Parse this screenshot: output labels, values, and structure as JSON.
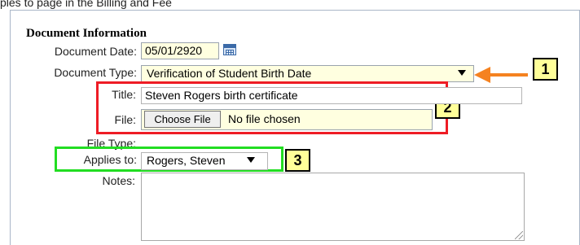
{
  "page": {
    "top_caption": "ples to page in the Billing and Fee"
  },
  "section": {
    "title": "Document Information"
  },
  "fields": {
    "document_date": {
      "label": "Document Date:",
      "value": "05/01/2920"
    },
    "document_type": {
      "label": "Document Type:",
      "value": "Verification of Student Birth Date"
    },
    "title": {
      "label": "Title:",
      "value": "Steven Rogers birth certificate"
    },
    "file": {
      "label": "File:",
      "button_label": "Choose File",
      "status": "No file chosen"
    },
    "file_type": {
      "label": "File Type:"
    },
    "applies_to": {
      "label": "Applies to:",
      "value": "Rogers, Steven"
    },
    "notes": {
      "label": "Notes:",
      "value": ""
    }
  },
  "callouts": {
    "one": {
      "number": "1",
      "color": "#f58220"
    },
    "two": {
      "number": "2",
      "color": "#ee1c25"
    },
    "three": {
      "number": "3",
      "color": "#22dd22"
    }
  },
  "icons": {
    "calendar": "calendar-icon",
    "dropdown": "triangle-down",
    "arrow": "arrow-left",
    "resize": "resize-grip"
  }
}
